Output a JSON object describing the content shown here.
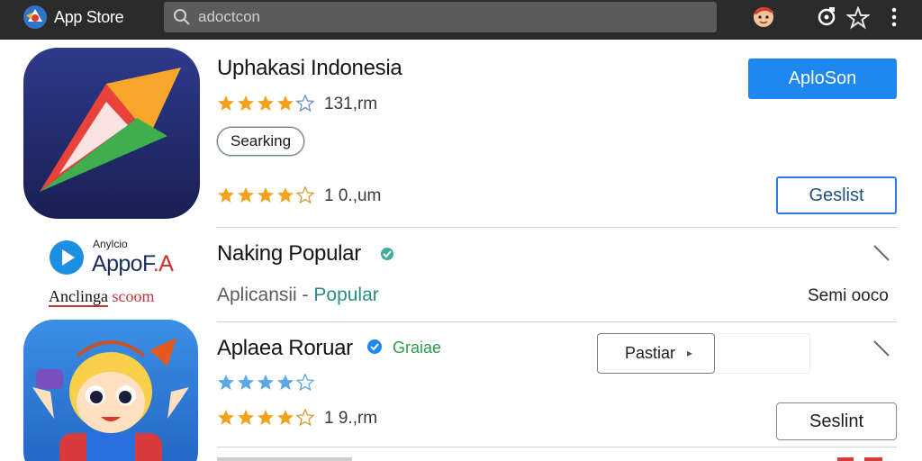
{
  "topbar": {
    "app_name": "App Store",
    "search_placeholder": "adoctcon"
  },
  "left_brand": {
    "small": "Anylcio",
    "big_main": "AppoF",
    "big_accent": ".A",
    "footer_main": "Anclinga",
    "footer_accent": "scoom"
  },
  "apps": [
    {
      "title": "Uphakasi Indonesia",
      "rating_count": "131,rm",
      "rating_count_2": "1 0.,um",
      "chip": "Searking",
      "primary_button": "AploSon",
      "secondary_button": "Geslist"
    },
    {
      "title": "Naking Popular",
      "subtitle_main": "Aplicansii",
      "subtitle_sep": " - ",
      "subtitle_accent": "Popular",
      "size": "Semi ooco"
    },
    {
      "title": "Aplaea Roruar",
      "tag": "Graiae",
      "mid_button": "Pastiar",
      "mid_button_arrow": "▸",
      "rating_count": "1 9.,rm",
      "button": "Seslint"
    }
  ],
  "colors": {
    "topbar_bg": "#2b2b2b",
    "accent_blue": "#1e88f0",
    "star_orange": "#f4a21e",
    "star_blue": "#5aa8e6",
    "tag_green": "#2f9b4e"
  }
}
